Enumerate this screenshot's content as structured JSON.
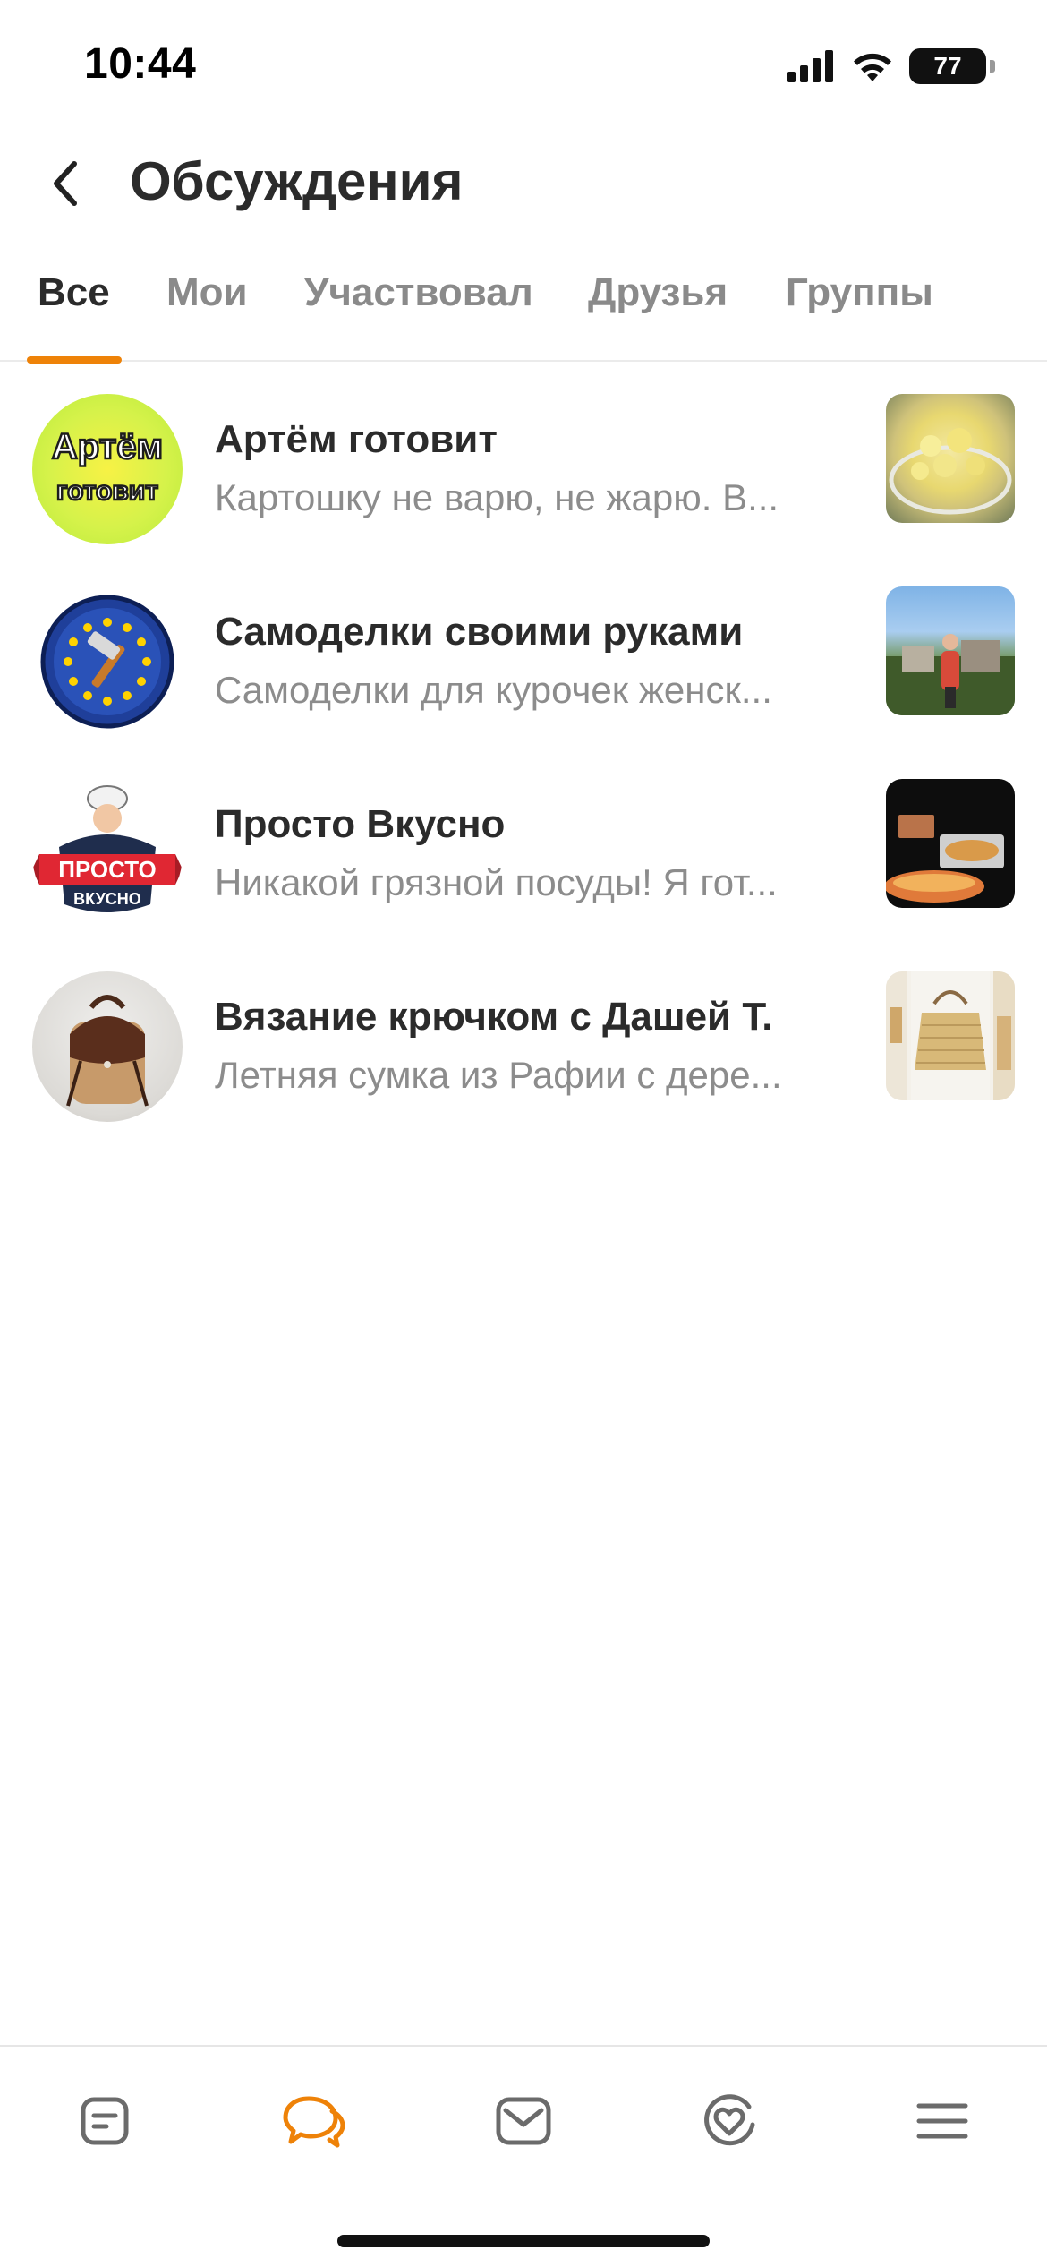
{
  "status_bar": {
    "time": "10:44",
    "battery": "77"
  },
  "header": {
    "title": "Обсуждения"
  },
  "tabs": [
    {
      "label": "Все",
      "active": true
    },
    {
      "label": "Мои",
      "active": false
    },
    {
      "label": "Участвовал",
      "active": false
    },
    {
      "label": "Друзья",
      "active": false
    },
    {
      "label": "Группы",
      "active": false
    }
  ],
  "discussions": [
    {
      "title": "Артём готовит",
      "preview": "Картошку не варю, не жарю. В...",
      "avatar_text": [
        "Артём",
        "готовит"
      ]
    },
    {
      "title": "Самоделки своими руками",
      "preview": "Самоделки для курочек женск...",
      "avatar_icon": "hammer-in-stars-icon"
    },
    {
      "title": "Просто Вкусно",
      "preview": "Никакой грязной посуды! Я гот...",
      "avatar_text": [
        "ПРОСТО",
        "ВКУСНО"
      ]
    },
    {
      "title": "Вязание крючком с Дашей Т.",
      "preview": "Летняя сумка из Рафии с дере...",
      "avatar_icon": "backpack-icon"
    }
  ],
  "bottom_nav": [
    {
      "icon": "feed-icon",
      "active": false
    },
    {
      "icon": "discussions-icon",
      "active": true
    },
    {
      "icon": "messages-icon",
      "active": false
    },
    {
      "icon": "friends-heart-icon",
      "active": false
    },
    {
      "icon": "menu-icon",
      "active": false
    }
  ],
  "colors": {
    "accent": "#ee8208",
    "text_primary": "#2b2b2b",
    "text_secondary": "#8c8c8c"
  }
}
